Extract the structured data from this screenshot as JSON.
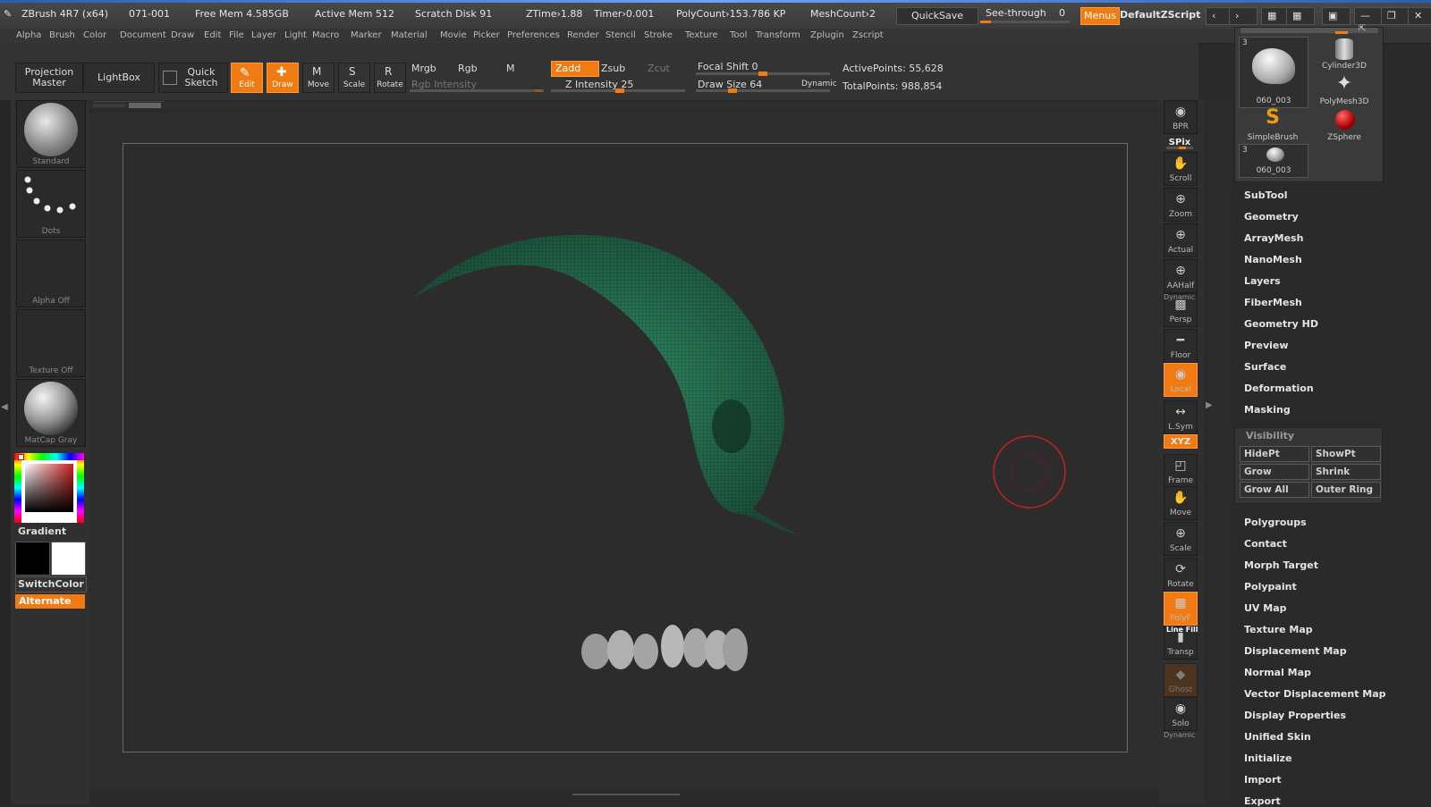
{
  "titlebar": {
    "app": "ZBrush 4R7 (x64)",
    "build": "071-001",
    "free_mem": "Free Mem 4.585GB",
    "active_mem": "Active Mem 512",
    "scratch": "Scratch Disk 91",
    "ztime": "ZTime›1.88",
    "timer": "Timer›0.001",
    "polycount": "PolyCount›153.786 KP",
    "meshcount": "MeshCount›2",
    "quicksave": "QuickSave",
    "seethrough": "See-through",
    "seethrough_value": "0",
    "menus": "Menus",
    "script": "DefaultZScript"
  },
  "menu": [
    "Alpha",
    "Brush",
    "Color",
    "Document",
    "Draw",
    "Edit",
    "File",
    "Layer",
    "Light",
    "Macro",
    "Marker",
    "Material",
    "Movie",
    "Picker",
    "Preferences",
    "Render",
    "Stencil",
    "Stroke",
    "Texture",
    "Tool",
    "Transform",
    "Zplugin",
    "Zscript"
  ],
  "toolbar": {
    "projection_master": "Projection Master",
    "lightbox": "LightBox",
    "quick_sketch": "Quick Sketch",
    "edit": "Edit",
    "draw": "Draw",
    "move": "Move",
    "scale": "Scale",
    "rotate": "Rotate",
    "mrgb": "Mrgb",
    "rgb": "Rgb",
    "m": "M",
    "zadd": "Zadd",
    "zsub": "Zsub",
    "zcut": "Zcut",
    "rgb_intensity": "Rgb Intensity",
    "z_intensity": "Z Intensity 25",
    "z_intensity_value": 25,
    "focal_shift": "Focal Shift 0",
    "focal_shift_value": 0,
    "draw_size": "Draw Size 64",
    "draw_size_value": 64,
    "dynamic": "Dynamic",
    "active_points": "ActivePoints: 55,628",
    "total_points": "TotalPoints: 988,854"
  },
  "leftshelf": {
    "brush": "Standard",
    "stroke": "Dots",
    "alpha": "Alpha Off",
    "texture": "Texture Off",
    "material": "MatCap Gray",
    "gradient": "Gradient",
    "switchcolor": "SwitchColor",
    "alternate": "Alternate",
    "primary_color": "#000000",
    "secondary_color": "#ffffff"
  },
  "rightshelf": [
    "BPR",
    "SPix",
    "Scroll",
    "Zoom",
    "Actual",
    "AAHalf",
    "Persp",
    "Floor",
    "Local",
    "L.Sym",
    "XYZ",
    "Frame",
    "Move",
    "Scale",
    "Rotate",
    "PolyF",
    "Transp",
    "Ghost",
    "Solo"
  ],
  "rightshelf_extra": {
    "dynamic": "Dynamic",
    "linefill": "Line Fill"
  },
  "toolpalette": {
    "count1": "3",
    "count2": "3",
    "items": [
      "060_003",
      "Cylinder3D",
      "PolyMesh3D",
      "SimpleBrush",
      "ZSphere",
      "060_003"
    ]
  },
  "tool_menu": [
    "SubTool",
    "Geometry",
    "ArrayMesh",
    "NanoMesh",
    "Layers",
    "FiberMesh",
    "Geometry HD",
    "Preview",
    "Surface",
    "Deformation",
    "Masking"
  ],
  "visibility": {
    "title": "Visibility",
    "buttons": [
      "HidePt",
      "ShowPt",
      "Grow",
      "Shrink",
      "Grow All",
      "Outer Ring"
    ]
  },
  "tool_menu2": [
    "Polygroups",
    "Contact",
    "Morph Target",
    "Polypaint",
    "UV Map",
    "Texture Map",
    "Displacement Map",
    "Normal Map",
    "Vector Displacement Map",
    "Display Properties",
    "Unified Skin",
    "Initialize",
    "Import",
    "Export"
  ],
  "colors": {
    "accent": "#ef7b12",
    "mesh": "#2e8a63",
    "brush_cursor": "#c62020"
  }
}
